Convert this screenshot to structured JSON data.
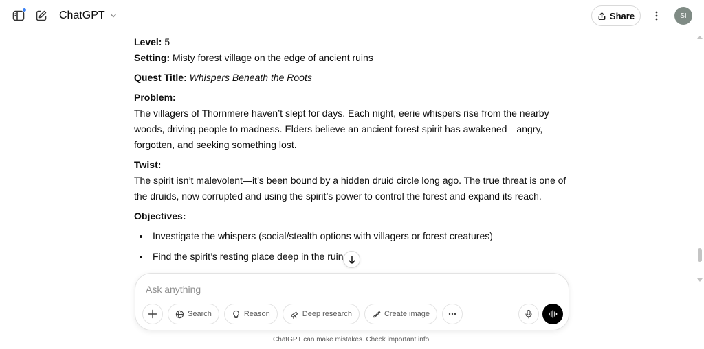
{
  "header": {
    "model_name": "ChatGPT",
    "share_label": "Share",
    "avatar_initials": "SI"
  },
  "message": {
    "level_label": "Level:",
    "level_value": " 5",
    "setting_label": "Setting:",
    "setting_value": " Misty forest village on the edge of ancient ruins",
    "quest_label": "Quest Title:",
    "quest_value": "Whispers Beneath the Roots",
    "problem_label": "Problem:",
    "problem_text": "The villagers of Thornmere haven’t slept for days. Each night, eerie whispers rise from the nearby woods, driving people to madness. Elders believe an ancient forest spirit has awakened—angry, forgotten, and seeking something lost.",
    "twist_label": "Twist:",
    "twist_text": "The spirit isn’t malevolent—it’s been bound by a hidden druid circle long ago. The true threat is one of the druids, now corrupted and using the spirit’s power to control the forest and expand its reach.",
    "objectives_label": "Objectives:",
    "objectives": [
      "Investigate the whispers (social/stealth options with villagers or forest creatures)",
      "Find the spirit’s resting place deep in the ruins"
    ]
  },
  "composer": {
    "placeholder": "Ask anything",
    "tools": {
      "search": "Search",
      "reason": "Reason",
      "deep_research": "Deep research",
      "create_image": "Create image"
    }
  },
  "footer": {
    "disclaimer": "ChatGPT can make mistakes. Check important info."
  },
  "colors": {
    "accent_dot": "#3b82f6",
    "avatar_bg": "#7f8b85",
    "voice_button": "#000000"
  },
  "icons": [
    "sidebar-icon",
    "new-chat-icon",
    "chevron-down-icon",
    "share-icon",
    "more-vertical-icon",
    "arrow-down-icon",
    "plus-icon",
    "globe-icon",
    "lightbulb-icon",
    "telescope-icon",
    "brush-icon",
    "ellipsis-icon",
    "microphone-icon",
    "voice-wave-icon"
  ]
}
